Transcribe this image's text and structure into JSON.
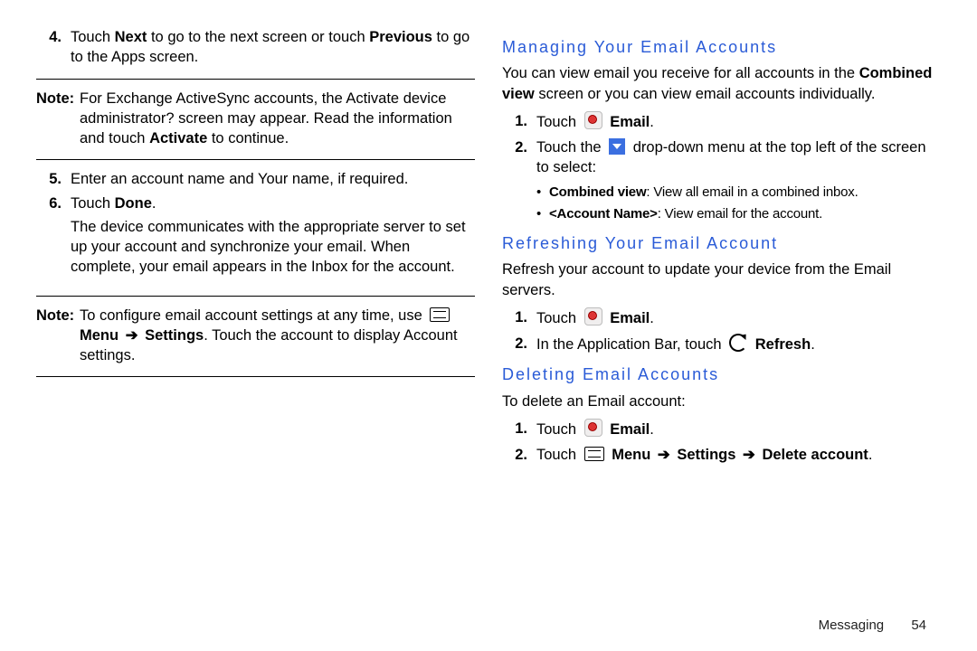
{
  "left": {
    "step4_num": "4.",
    "step4_a": "Touch ",
    "step4_b": "Next",
    "step4_c": " to go to the next screen or touch ",
    "step4_d": "Previous",
    "step4_e": " to go to the Apps screen.",
    "note1_label": "Note:",
    "note1_a": "For Exchange ActiveSync accounts, the Activate device administrator? screen may appear. Read the information and touch ",
    "note1_b": "Activate",
    "note1_c": " to continue.",
    "step5_num": "5.",
    "step5": "Enter an account name and Your name, if required.",
    "step6_num": "6.",
    "step6_a": "Touch ",
    "step6_b": "Done",
    "step6_c": ".",
    "step6_body": "The device communicates with the appropriate server to set up your account and synchronize your email. When complete, your email appears in the Inbox for the account.",
    "note2_label": "Note:",
    "note2_a": "To configure email account settings at any time, use ",
    "note2_menu": "Menu",
    "note2_arrow": "➔",
    "note2_settings": "Settings",
    "note2_b": ". Touch the account to display Account settings."
  },
  "right": {
    "h1": "Managing Your Email Accounts",
    "p1_a": "You can view email you receive for all accounts in the ",
    "p1_b": "Combined view",
    "p1_c": " screen or you can view email accounts individually.",
    "m1_num": "1.",
    "m1_a": "Touch ",
    "m1_b": "Email",
    "m1_c": ".",
    "m2_num": "2.",
    "m2_a": "Touch the ",
    "m2_b": " drop-down menu at the top left of the screen to select:",
    "mb1_a": "Combined view",
    "mb1_b": ": View all email in a combined inbox.",
    "mb2_a": "<Account Name>",
    "mb2_b": ": View email for the account.",
    "h2": "Refreshing Your Email Account",
    "p2": "Refresh your account to update your device from the Email servers.",
    "r1_num": "1.",
    "r1_a": "Touch ",
    "r1_b": "Email",
    "r1_c": ".",
    "r2_num": "2.",
    "r2_a": "In the Application Bar, touch ",
    "r2_b": "Refresh",
    "r2_c": ".",
    "h3": "Deleting Email Accounts",
    "p3": "To delete an Email account:",
    "d1_num": "1.",
    "d1_a": "Touch ",
    "d1_b": "Email",
    "d1_c": ".",
    "d2_num": "2.",
    "d2_a": "Touch ",
    "d2_menu": "Menu",
    "d2_arrow1": "➔",
    "d2_settings": "Settings",
    "d2_arrow2": "➔",
    "d2_delete": "Delete account",
    "d2_end": "."
  },
  "footer": {
    "section": "Messaging",
    "page": "54"
  }
}
